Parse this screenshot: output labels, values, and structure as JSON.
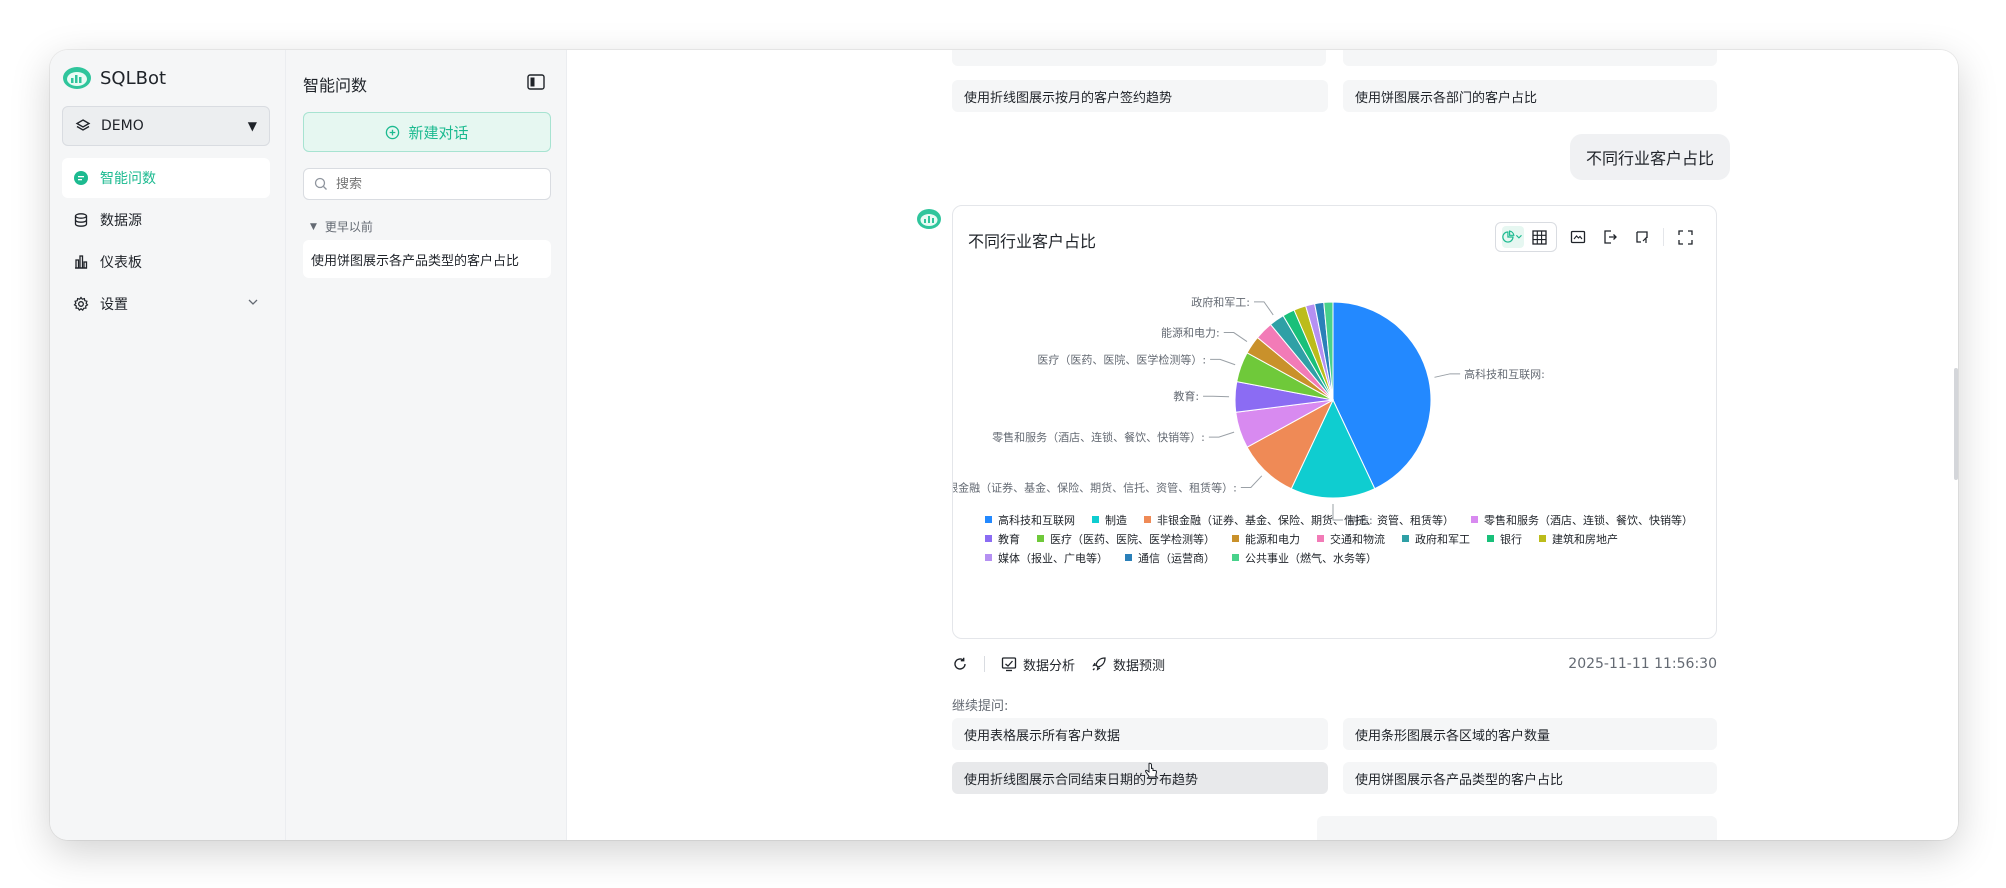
{
  "app": {
    "name": "SQLBot"
  },
  "datasource": {
    "selected": "DEMO"
  },
  "nav": {
    "items": [
      {
        "label": "智能问数",
        "icon": "chat-icon",
        "active": true
      },
      {
        "label": "数据源",
        "icon": "database-icon"
      },
      {
        "label": "仪表板",
        "icon": "dashboard-icon"
      },
      {
        "label": "设置",
        "icon": "gear-icon"
      }
    ]
  },
  "panel": {
    "title": "智能问数",
    "new_chat": "新建对话",
    "search_placeholder": "搜索",
    "group_label": "更早以前",
    "chats": [
      "使用饼图展示各产品类型的客户占比"
    ]
  },
  "main": {
    "top_suggestions": [
      "使用折线图展示按月的客户签约趋势",
      "使用饼图展示各部门的客户占比"
    ],
    "user_question": "不同行业客户占比",
    "card_title": "不同行业客户占比",
    "actions": {
      "analysis": "数据分析",
      "predict": "数据预测"
    },
    "timestamp": "2025-11-11 11:56:30",
    "followup_label": "继续提问:",
    "followups": [
      "使用表格展示所有客户数据",
      "使用条形图展示各区域的客户数量",
      "使用折线图展示合同结束日期的分布趋势",
      "使用饼图展示各产品类型的客户占比"
    ]
  },
  "colors": {
    "accent": "#1cba90"
  },
  "chart_data": {
    "type": "pie",
    "title": "不同行业客户占比",
    "legend_position": "bottom",
    "slices": [
      {
        "name": "高科技和互联网",
        "value": 43,
        "color": "#2389ff"
      },
      {
        "name": "制造",
        "value": 14,
        "color": "#0fcdd0"
      },
      {
        "name": "非银金融（证券、基金、保险、期货、信托、资管、租赁等）",
        "value": 10,
        "color": "#ef8a56"
      },
      {
        "name": "零售和服务（酒店、连锁、餐饮、快销等）",
        "value": 6,
        "color": "#d88af0"
      },
      {
        "name": "教育",
        "value": 5,
        "color": "#8b6cf3"
      },
      {
        "name": "医疗（医药、医院、医学检测等）",
        "value": 5,
        "color": "#6fc93a"
      },
      {
        "name": "能源和电力",
        "value": 3,
        "color": "#c9912b"
      },
      {
        "name": "交通和物流",
        "value": 3,
        "color": "#f27bb7"
      },
      {
        "name": "政府和军工",
        "value": 2.5,
        "color": "#2fa0a6"
      },
      {
        "name": "银行",
        "value": 2,
        "color": "#19c07a"
      },
      {
        "name": "建筑和房地产",
        "value": 2,
        "color": "#bcbc1b"
      },
      {
        "name": "媒体（报业、广电等）",
        "value": 1.5,
        "color": "#b590f2"
      },
      {
        "name": "通信（运营商）",
        "value": 1.5,
        "color": "#2a80b9"
      },
      {
        "name": "公共事业（燃气、水务等）",
        "value": 1.5,
        "color": "#48d28b"
      }
    ],
    "outer_labels": [
      {
        "text": "高科技和互联网:",
        "slice": 0
      },
      {
        "text": "制造:",
        "slice": 1
      },
      {
        "text": "非银金融（证券、基金、保险、期货、信托、资管、租赁等）:",
        "slice": 2
      },
      {
        "text": "零售和服务（酒店、连锁、餐饮、快销等）:",
        "slice": 3
      },
      {
        "text": "教育:",
        "slice": 4
      },
      {
        "text": "医疗（医药、医院、医学检测等）:",
        "slice": 5
      },
      {
        "text": "能源和电力:",
        "slice": 6
      },
      {
        "text": "政府和军工:",
        "slice": 8
      }
    ]
  }
}
